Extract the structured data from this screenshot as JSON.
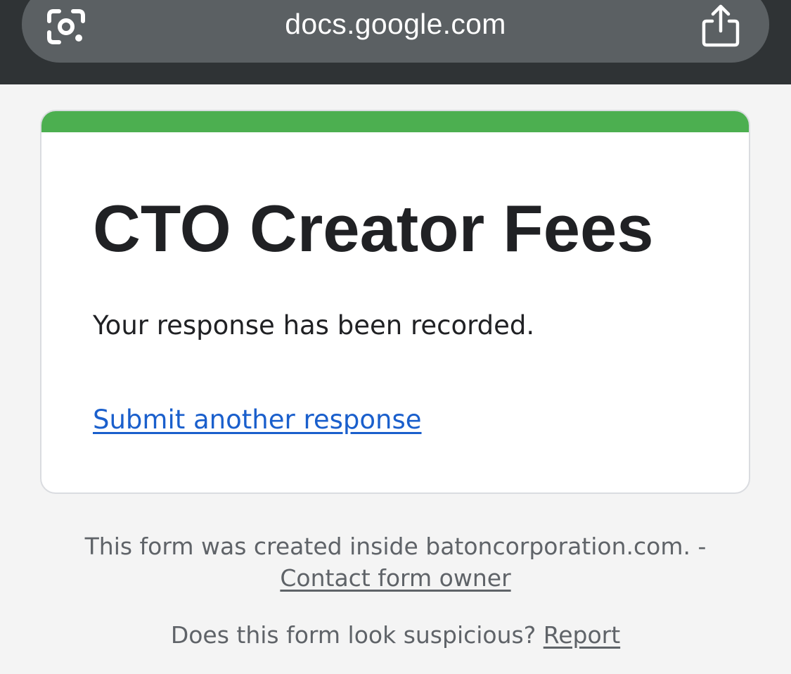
{
  "browser": {
    "url": "docs.google.com",
    "left_icon": "lens-icon",
    "right_icon": "share-icon"
  },
  "form": {
    "title": "CTO Creator Fees",
    "confirmation": "Your response has been recorded.",
    "submit_another": "Submit another response",
    "accent_color": "#4caf50"
  },
  "footer": {
    "created_inside": "This form was created inside batoncorporation.com. -",
    "contact_owner": "Contact form owner",
    "suspicious_question": "Does this form look suspicious?",
    "report": "Report"
  }
}
